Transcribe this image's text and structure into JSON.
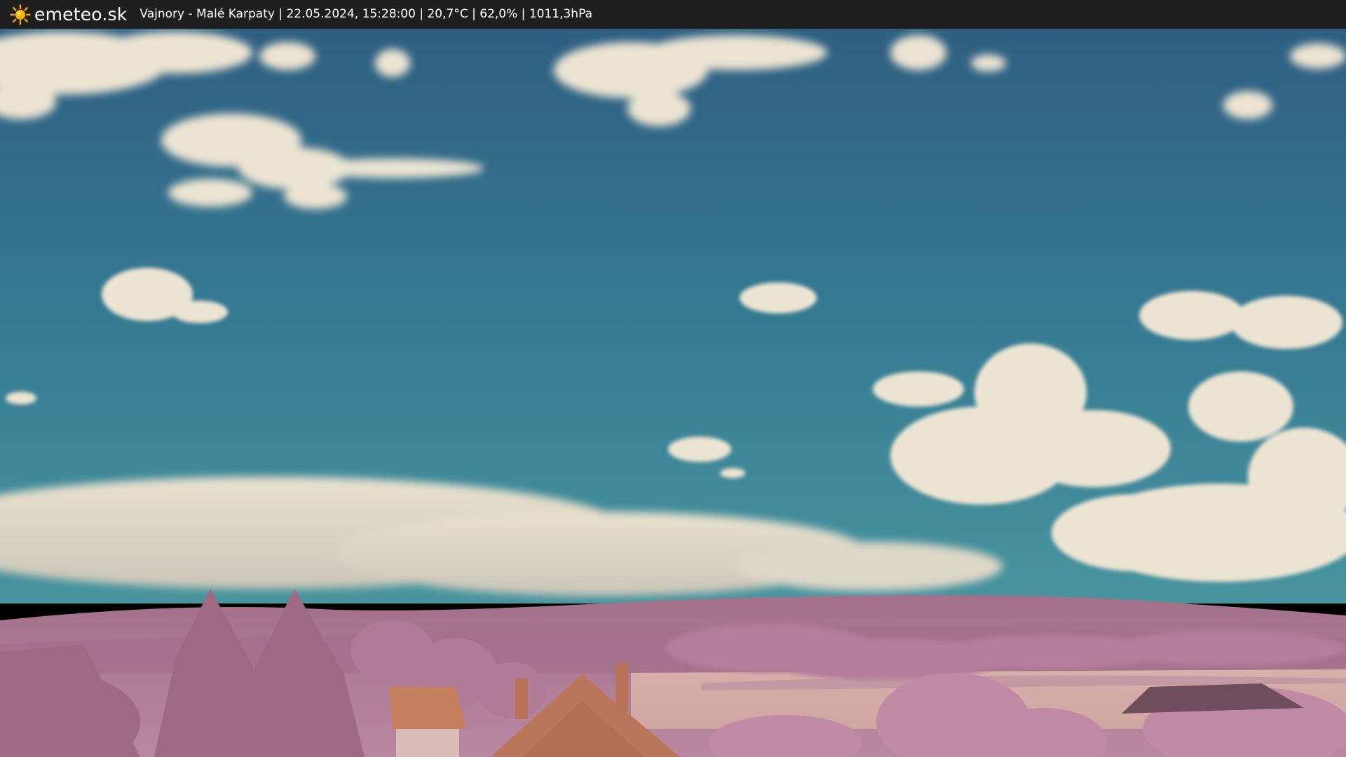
{
  "header": {
    "brand": "emeteo.sk",
    "logo_icon": "sun-icon",
    "location": "Vajnory - Malé Karpaty",
    "datetime": "22.05.2024, 15:28:00",
    "temperature": "20,7°C",
    "humidity": "62,0%",
    "pressure": "1011,3hPa",
    "separator": " | "
  },
  "colors": {
    "bar_background": "#1f1f1f",
    "sky_top": "#2f5f82",
    "sky_bottom": "#3f8ea0",
    "cloud": "#ece4d2",
    "foliage": "#b77c98",
    "roof": "#c47f5e"
  },
  "image": {
    "kind": "infrared webcam snapshot"
  }
}
